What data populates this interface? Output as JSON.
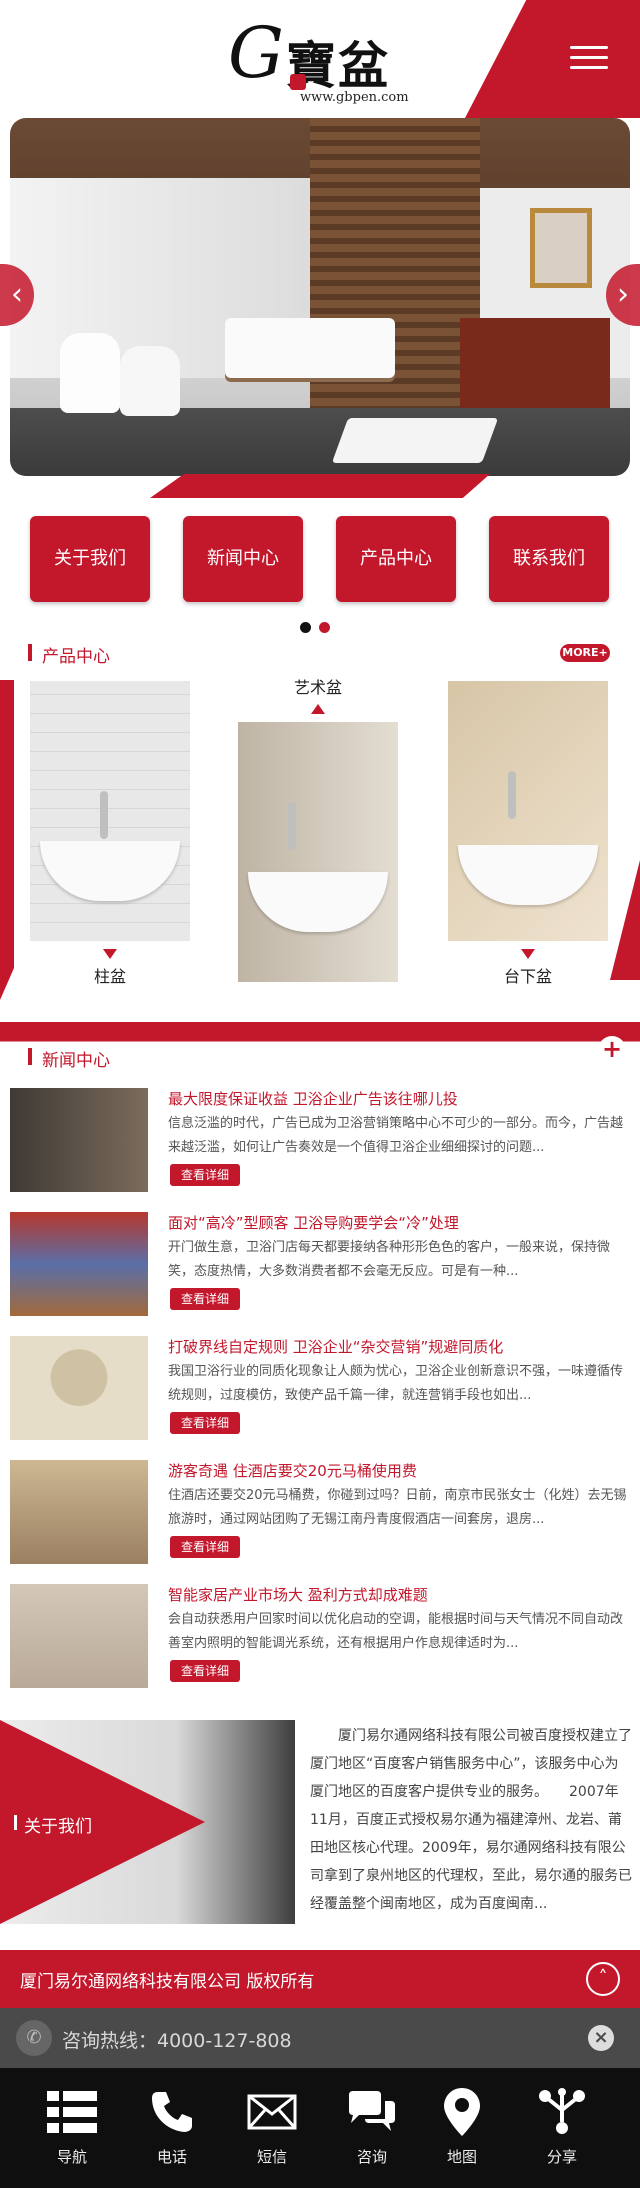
{
  "header": {
    "logo_g": "G",
    "logo_cn": "寶盆",
    "logo_url": "www.gbpen.com"
  },
  "quick_nav": [
    "关于我们",
    "新闻中心",
    "产品中心",
    "联系我们"
  ],
  "products": {
    "title": "产品中心",
    "more": "MORE+",
    "items": [
      {
        "label": "柱盆"
      },
      {
        "label": "艺术盆"
      },
      {
        "label": "台下盆"
      }
    ]
  },
  "news": {
    "title": "新闻中心",
    "more": "+",
    "btn_label": "查看详细",
    "items": [
      {
        "title": "最大限度保证收益 卫浴企业广告该往哪儿投",
        "desc": "信息泛滥的时代，广告已成为卫浴营销策略中心不可少的一部分。而今，广告越来越泛滥，如何让广告奏效是一个值得卫浴企业细细探讨的问题..."
      },
      {
        "title": "面对“高冷”型顾客 卫浴导购要学会“冷”处理",
        "desc": "开门做生意，卫浴门店每天都要接纳各种形形色色的客户，一般来说，保持微笑，态度热情，大多数消费者都不会毫无反应。可是有一种..."
      },
      {
        "title": "打破界线自定规则 卫浴企业“杂交营销”规避同质化",
        "desc": "我国卫浴行业的同质化现象让人颇为忧心，卫浴企业创新意识不强，一味遵循传统规则，过度模仿，致使产品千篇一律，就连营销手段也如出..."
      },
      {
        "title": "游客奇遇 住酒店要交20元马桶使用费",
        "desc": "住酒店还要交20元马桶费，你碰到过吗？日前，南京市民张女士（化姓）去无锡旅游时，通过网站团购了无锡江南丹青度假酒店一间套房，退房..."
      },
      {
        "title": "智能家居产业市场大 盈利方式却成难题",
        "desc": "会自动获悉用户回家时间以优化启动的空调，能根据时间与天气情况不同自动改善室内照明的智能调光系统，还有根据用户作息规律适时为..."
      }
    ]
  },
  "about": {
    "title": "关于我们",
    "text": "　　厦门易尔通网络科技有限公司被百度授权建立了厦门地区“百度客户销售服务中心”，该服务中心为厦门地区的百度客户提供专业的服务。　　2007年11月，百度正式授权易尔通为福建漳州、龙岩、莆田地区核心代理。2009年，易尔通网络科技有限公司拿到了泉州地区的代理权，至此，易尔通的服务已经覆盖整个闽南地区，成为百度闽南..."
  },
  "footer": {
    "copyright": "厦门易尔通网络科技有限公司 版权所有",
    "hotline": "咨询热线：4000-127-808"
  },
  "tabbar": [
    {
      "label": "导航",
      "icon": "grid-list-icon"
    },
    {
      "label": "电话",
      "icon": "phone-icon"
    },
    {
      "label": "短信",
      "icon": "envelope-icon"
    },
    {
      "label": "咨询",
      "icon": "chat-bubbles-icon"
    },
    {
      "label": "地图",
      "icon": "map-pin-icon"
    },
    {
      "label": "分享",
      "icon": "share-icon"
    }
  ],
  "colors": {
    "brand_red": "#c3172c",
    "dark": "#0f0f0f",
    "hotline_bg": "#4a4a4a"
  }
}
